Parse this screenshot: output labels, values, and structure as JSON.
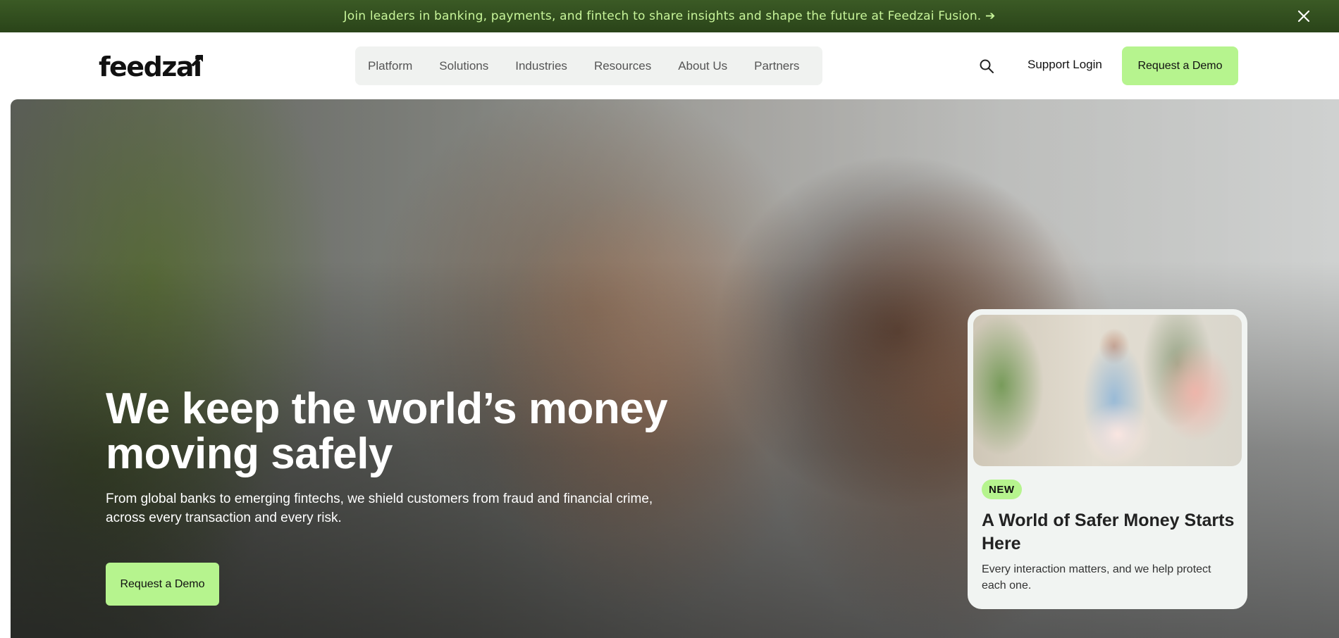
{
  "banner": {
    "text": "Join leaders in banking, payments, and fintech to share insights and shape the future at Feedzai Fusion. ➔",
    "close_icon": "close-icon"
  },
  "header": {
    "logo_text": "feedzai",
    "nav": [
      {
        "label": "Platform"
      },
      {
        "label": "Solutions"
      },
      {
        "label": "Industries"
      },
      {
        "label": "Resources"
      },
      {
        "label": "About Us"
      },
      {
        "label": "Partners"
      }
    ],
    "search_icon": "search-icon",
    "support_login": "Support Login",
    "cta": "Request a Demo"
  },
  "hero": {
    "title": "We keep the world’s money moving safely",
    "subtitle": "From global banks to emerging fintechs, we shield customers from fraud and financial crime, across every transaction and every risk.",
    "cta": "Request a Demo"
  },
  "promo": {
    "badge": "NEW",
    "title": "A World of Safer Money Starts Here",
    "description": "Every interaction matters, and we help protect each one."
  },
  "colors": {
    "accent": "#b6f48e",
    "banner_bg": "#2f4a1e",
    "banner_text": "#c8f59a"
  }
}
